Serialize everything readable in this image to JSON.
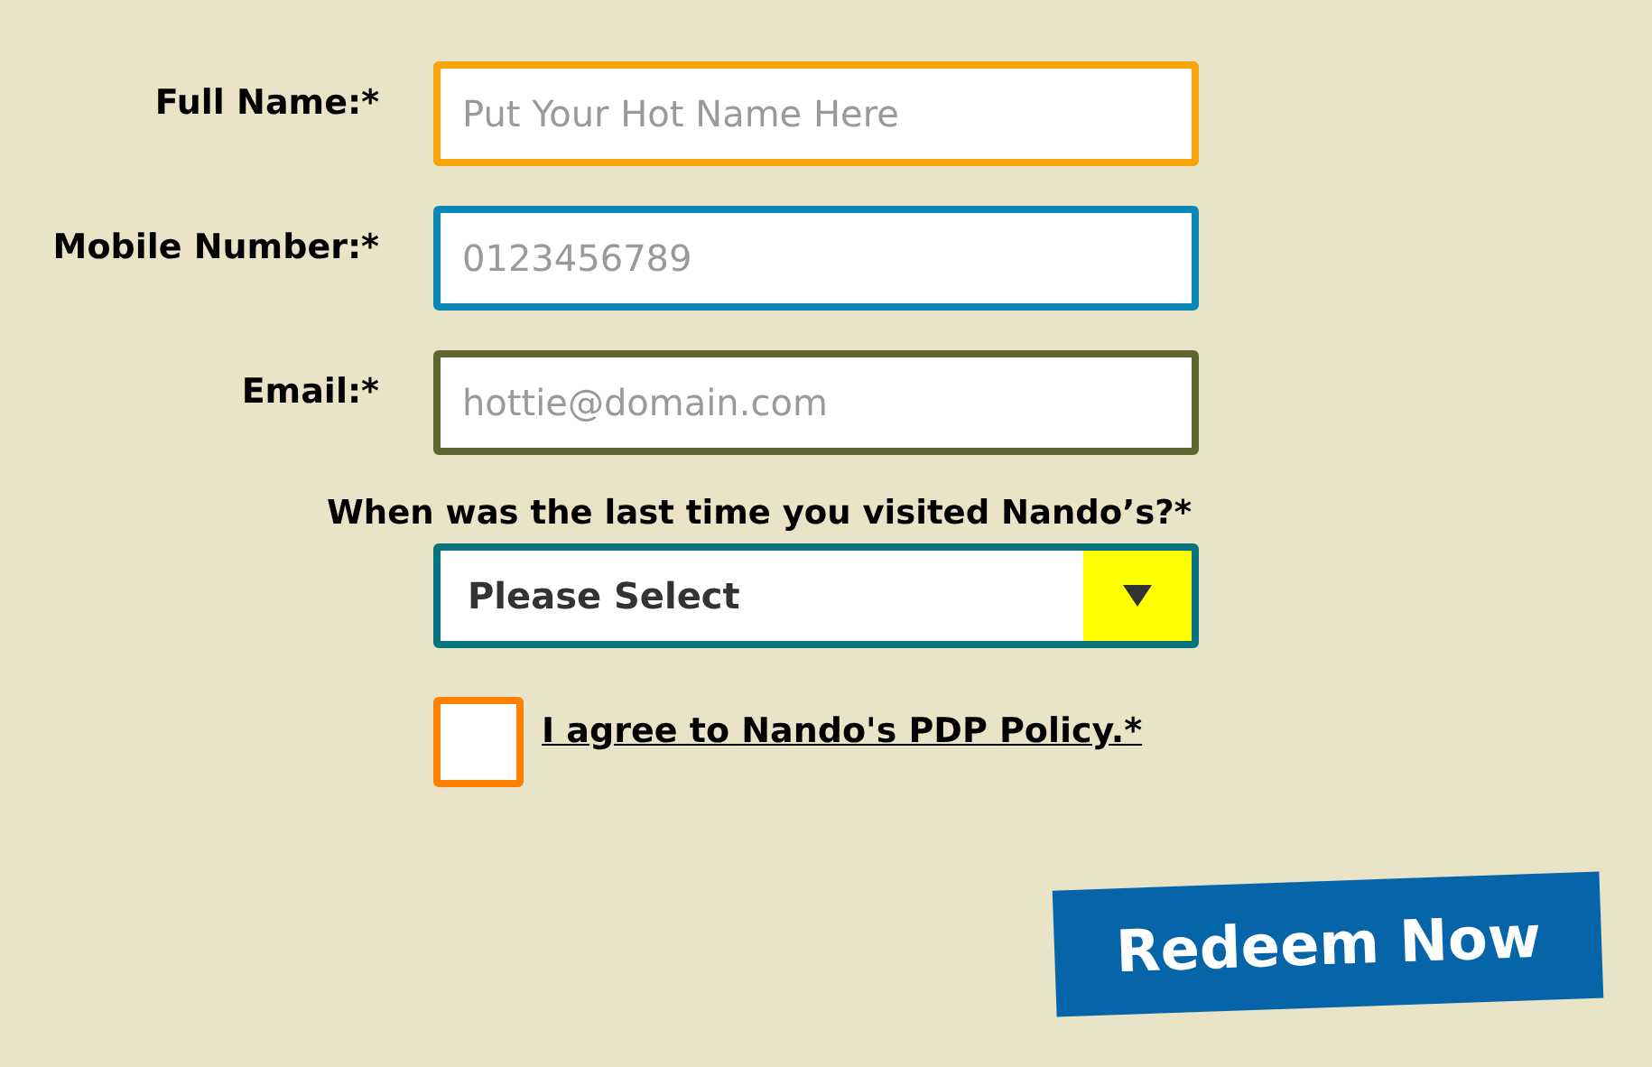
{
  "fields": [
    {
      "label": "Full Name:*",
      "placeholder": "Put Your Hot Name Here",
      "color": "#f7a30a"
    },
    {
      "label": "Mobile Number:*",
      "placeholder": "0123456789",
      "color": "#0b87b5"
    },
    {
      "label": "Email:*",
      "placeholder": "hottie@domain.com",
      "color": "#5f6530"
    }
  ],
  "visit": {
    "question": "When was the last time you visited Nando’s?*",
    "value": "Please Select"
  },
  "agree": {
    "label": "I agree to Nando's PDP Policy.*",
    "checked": false
  },
  "submit": "Redeem Now"
}
